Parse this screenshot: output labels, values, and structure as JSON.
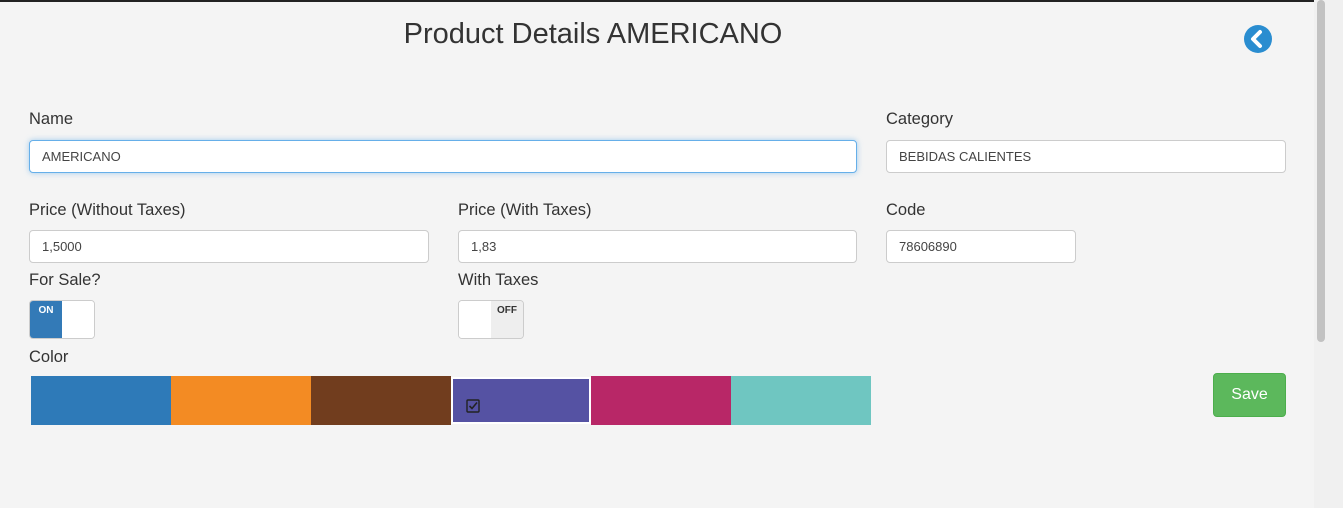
{
  "page": {
    "title": "Product Details AMERICANO"
  },
  "icons": {
    "back": "chevron-left-circle-icon",
    "selected_color": "checkbox-checked-icon"
  },
  "form": {
    "name": {
      "label": "Name",
      "value": "AMERICANO"
    },
    "category": {
      "label": "Category",
      "value": "BEBIDAS CALIENTES"
    },
    "price_without_taxes": {
      "label": "Price (Without Taxes)",
      "value": "1,5000"
    },
    "price_with_taxes": {
      "label": "Price (With Taxes)",
      "value": "1,83"
    },
    "code": {
      "label": "Code",
      "value": "78606890"
    },
    "for_sale": {
      "label": "For Sale?",
      "state": "ON",
      "on": true
    },
    "with_taxes": {
      "label": "With Taxes",
      "state": "OFF",
      "on": false
    },
    "color": {
      "label": "Color",
      "options": [
        "#2e7ab8",
        "#f38b23",
        "#713d1e",
        "#5552a3",
        "#b82767",
        "#6fc6c1"
      ],
      "selected_index": 3
    }
  },
  "actions": {
    "save_label": "Save"
  },
  "colors": {
    "accent": "#2a8dd0",
    "save": "#5cb85c",
    "toggle_on": "#337ab7"
  }
}
